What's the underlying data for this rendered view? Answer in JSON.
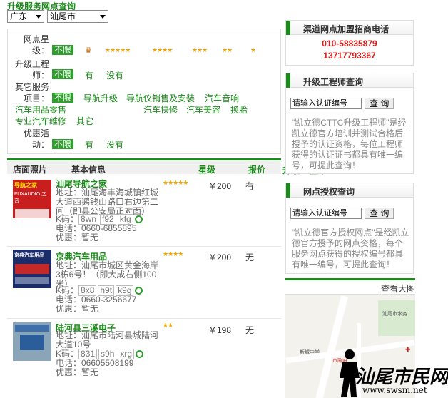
{
  "header": {
    "title": "升级服务网点查询"
  },
  "selects": {
    "province": "广东",
    "city": "汕尾市"
  },
  "filter": {
    "rating": {
      "label1": "网点星",
      "label2": "级：",
      "selected": "不限"
    },
    "engineer": {
      "label1": "升级工程",
      "label2": "师：",
      "selected": "不限",
      "options": [
        "有",
        "没有"
      ]
    },
    "other": {
      "label1": "其它服务",
      "label2": "项目：",
      "selected": "不限",
      "options": [
        "导航升级",
        "导航仪销售及安装",
        "汽车音响",
        "汽车用品零售",
        "汽车快修",
        "汽车美容",
        "换胎",
        "专业汽车维修",
        "其它"
      ]
    },
    "promo": {
      "label1": "优惠活",
      "label2": "动：",
      "selected": "不限",
      "options": [
        "有",
        "没有"
      ]
    }
  },
  "list": {
    "columns": {
      "photo": "店面照片",
      "info": "基本信息",
      "rank": "星级",
      "price": "报价",
      "engineer": "升级工程师"
    },
    "items": [
      {
        "name": "汕尾导航之家",
        "address": "地址：汕尾海丰海城镇红城大道西鹅钱山路口右边第二间（即县公安局正对面）",
        "k_label": "K码：",
        "k_codes": [
          "8wn",
          "f92",
          "kfg"
        ],
        "phone": "电话：0660-6855895",
        "promo": "优惠：暂无",
        "stars": 5,
        "price": "￥200",
        "engineer": "有"
      },
      {
        "name": "京典汽车用品",
        "address": "地址：汕尾市城区黄金海岸3栋6号！（即大成右侧100米）",
        "k_label": "K码：",
        "k_codes": [
          "8x8",
          "h9t",
          "k9g"
        ],
        "phone": "电话：0660-3256677",
        "promo": "优惠：暂无",
        "stars": 4,
        "price": "￥200",
        "engineer": "无"
      },
      {
        "name": "陆河县三溪电子",
        "address": "地址：汕尾市陆河县城陆河大道10号",
        "k_label": "K码：",
        "k_codes": [
          "831",
          "s9h",
          "xrg"
        ],
        "phone": "电话：06605508199",
        "promo": "优惠：暂无",
        "stars": 2,
        "price": "￥198",
        "engineer": "无"
      }
    ]
  },
  "panels": {
    "hotline": {
      "title": "渠道网点加盟招商电话",
      "phone1": "010-58835879",
      "phone2": "13717793367"
    },
    "engineer_query": {
      "title": "升级工程师查询",
      "placeholder": "请输入认证编号",
      "button": "查 询",
      "desc": "\"凯立德CTTC升级工程师\"是经凯立德官方培训并测试合格后授予的认证资格，每位工程师获得的认证证书都具有唯一编号，可提此查询！"
    },
    "outlet_query": {
      "title": "网点授权查询",
      "placeholder": "请输入认证编号",
      "button": "查 询",
      "desc": "\"凯立德官方授权网点\"是经凯立德官方授予的网点资格，每个服务网点获得的授权编号都具有唯一编号，可提此查询！"
    },
    "map": {
      "title": "查看大图",
      "labels": [
        "汕尾市水务",
        "新城中学",
        "市政府"
      ]
    }
  },
  "watermark": {
    "text": "汕尾市民网",
    "url": "www.swsm.net"
  },
  "colors": {
    "accent": "#1a8a1a",
    "phone": "#d42020",
    "star": "#f0a400"
  }
}
